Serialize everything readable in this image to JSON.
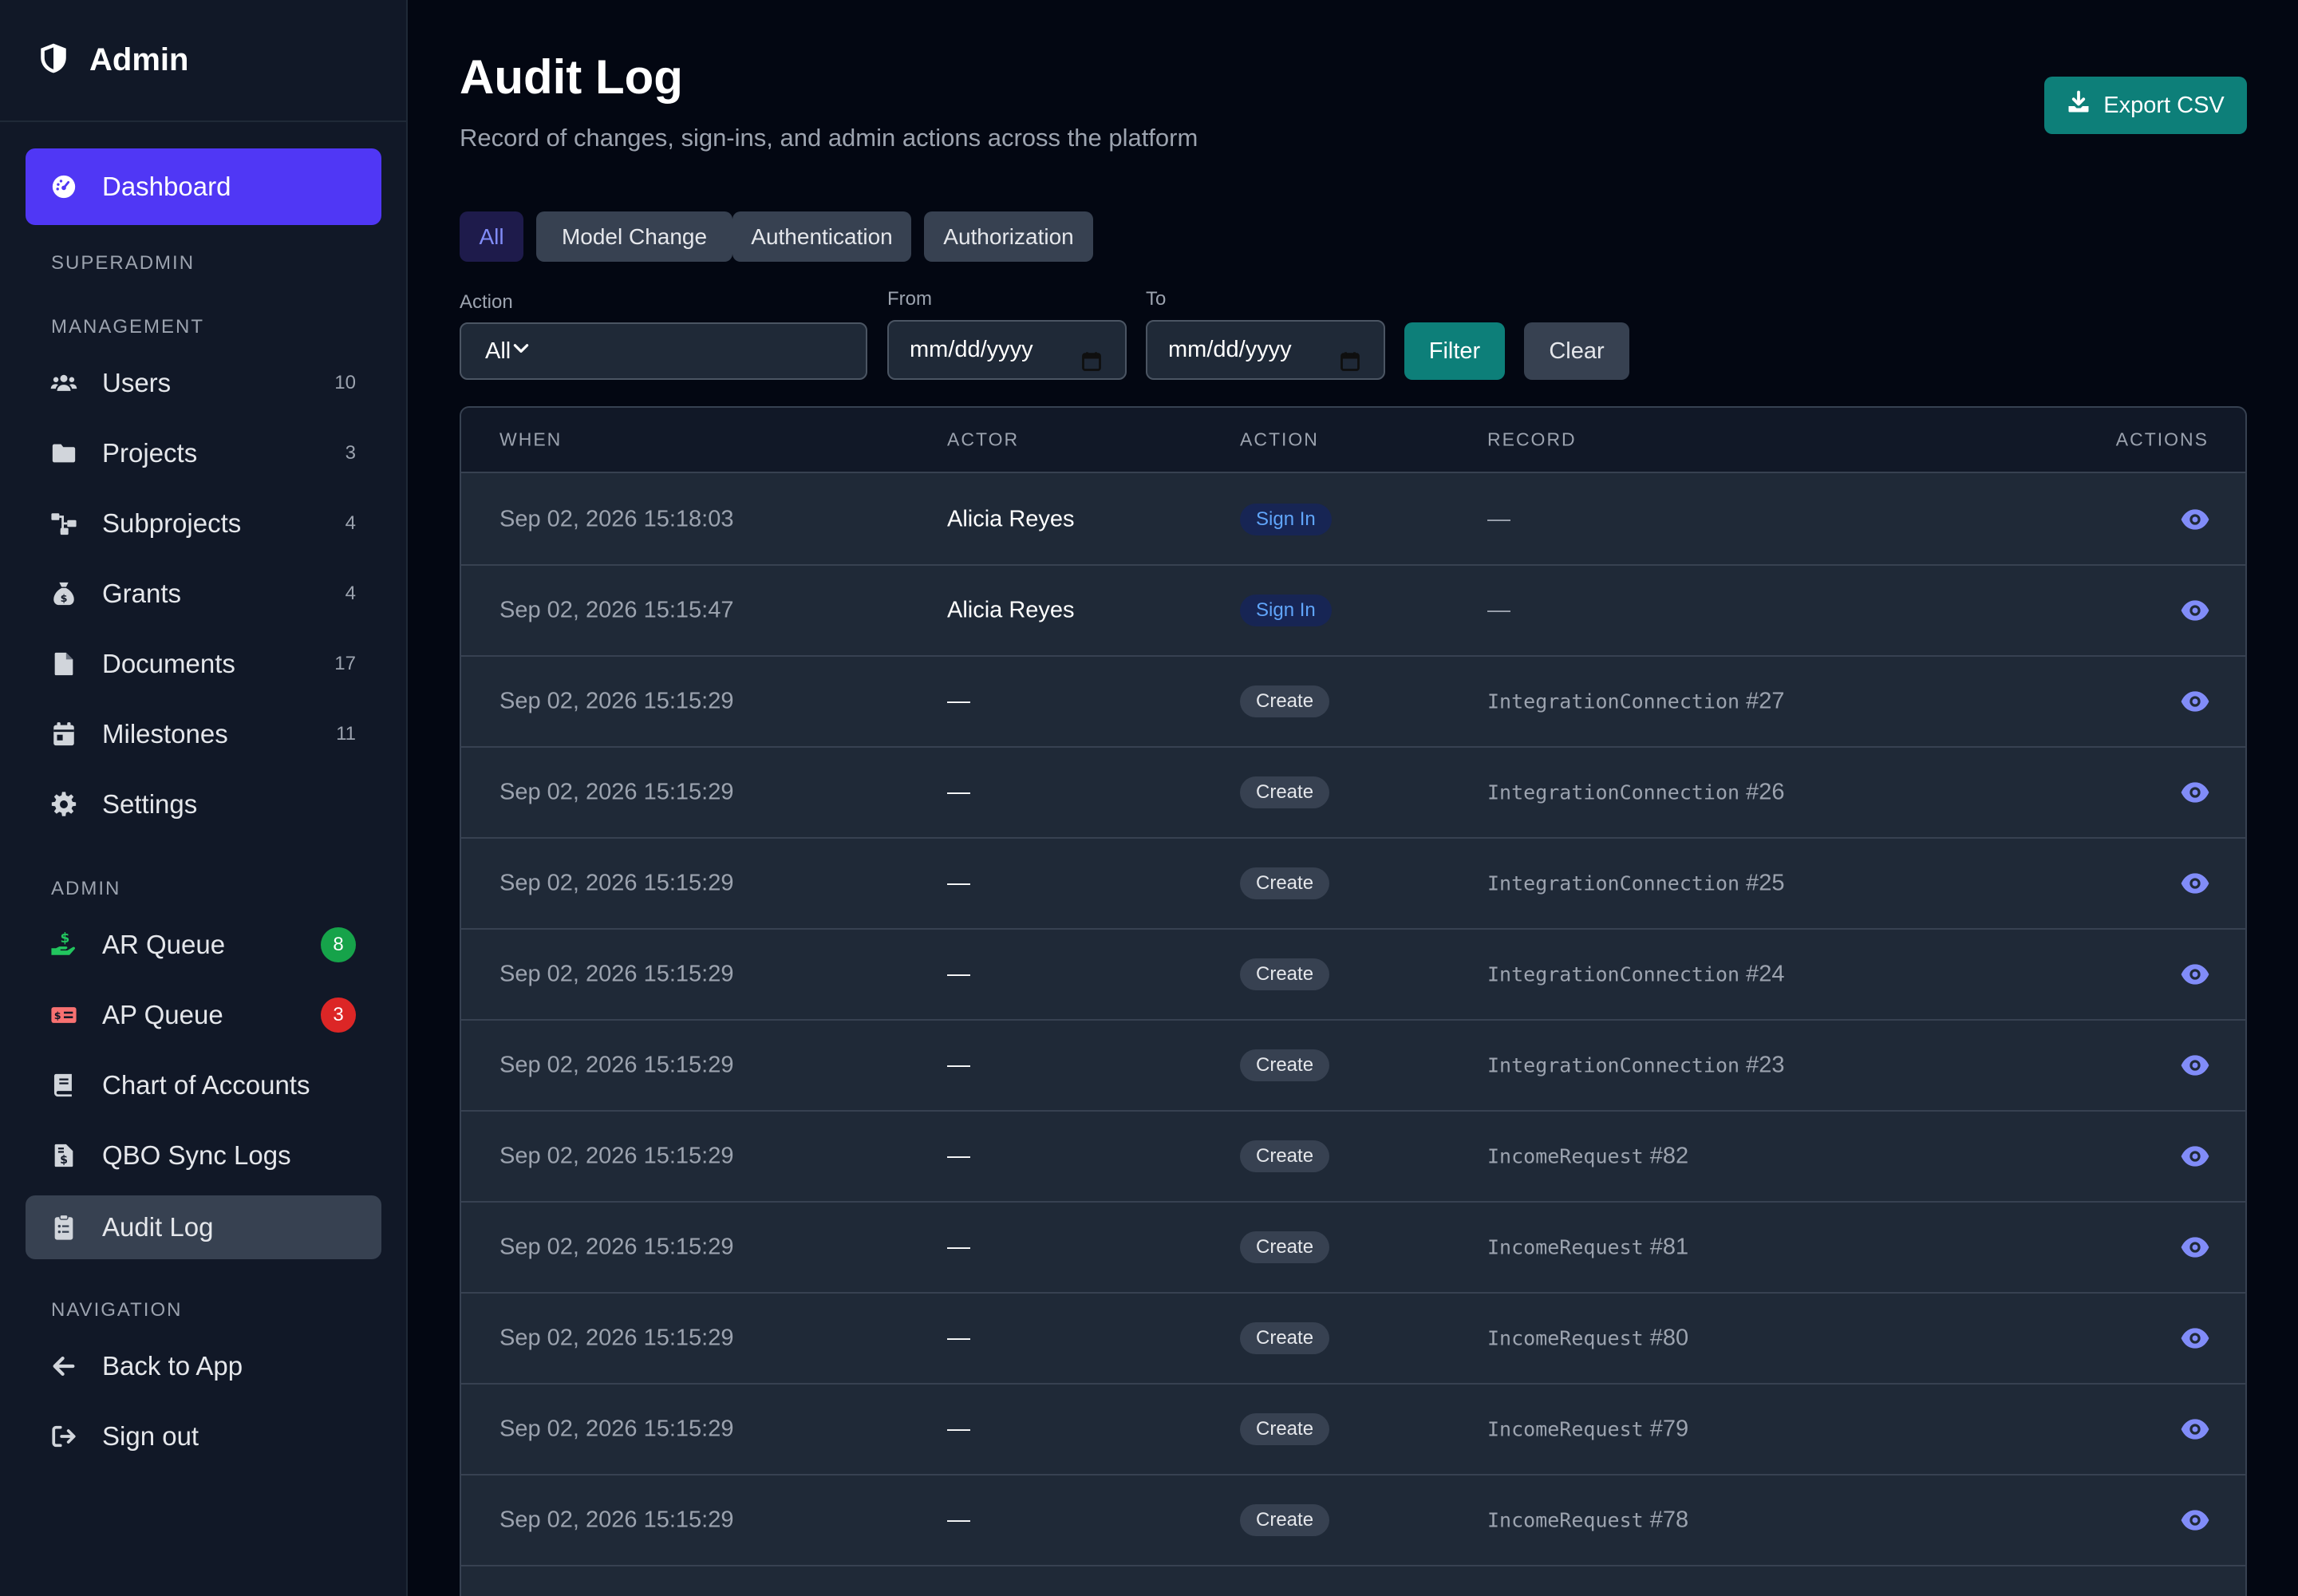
{
  "sidebar": {
    "brand": {
      "title": "Admin",
      "icon": "shield-icon"
    },
    "dashboard": {
      "label": "Dashboard",
      "icon": "gauge-icon"
    },
    "sections": {
      "superadmin": "SUPERADMIN",
      "management": "MANAGEMENT",
      "admin": "ADMIN",
      "navigation": "NAVIGATION"
    },
    "management": [
      {
        "label": "Users",
        "count": "10",
        "icon": "users-icon"
      },
      {
        "label": "Projects",
        "count": "3",
        "icon": "folder-icon"
      },
      {
        "label": "Subprojects",
        "count": "4",
        "icon": "sitemap-icon"
      },
      {
        "label": "Grants",
        "count": "4",
        "icon": "money-bag-icon"
      },
      {
        "label": "Documents",
        "count": "17",
        "icon": "file-icon"
      },
      {
        "label": "Milestones",
        "count": "11",
        "icon": "calendar-icon"
      },
      {
        "label": "Settings",
        "count": "",
        "icon": "gear-icon"
      }
    ],
    "admin": [
      {
        "label": "AR Queue",
        "badge": "8",
        "badge_color": "#16a34a",
        "icon": "hand-dollar-icon",
        "icon_color": "#22c55e"
      },
      {
        "label": "AP Queue",
        "badge": "3",
        "badge_color": "#dc2626",
        "icon": "money-check-icon",
        "icon_color": "#f87171"
      },
      {
        "label": "Chart of Accounts",
        "icon": "book-icon"
      },
      {
        "label": "QBO Sync Logs",
        "icon": "invoice-dollar-icon"
      },
      {
        "label": "Audit Log",
        "icon": "clipboard-list-icon"
      }
    ],
    "navigation": [
      {
        "label": "Back to App",
        "icon": "arrow-left-icon"
      },
      {
        "label": "Sign out",
        "icon": "sign-out-icon"
      }
    ]
  },
  "header": {
    "title": "Audit Log",
    "subtitle": "Record of changes, sign-ins, and admin actions across the platform",
    "export_label": "Export CSV"
  },
  "tabs": [
    {
      "label": "All",
      "active": true
    },
    {
      "label": "Model Change"
    },
    {
      "label": "Authentication"
    },
    {
      "label": "Authorization"
    }
  ],
  "filters": {
    "action_label": "Action",
    "action_value": "All",
    "from_label": "From",
    "from_placeholder": "mm/dd/yyyy",
    "to_label": "To",
    "to_placeholder": "mm/dd/yyyy",
    "filter_label": "Filter",
    "clear_label": "Clear"
  },
  "table": {
    "columns": [
      "WHEN",
      "ACTOR",
      "ACTION",
      "RECORD",
      "ACTIONS"
    ],
    "rows": [
      {
        "when": "Sep 02, 2026 15:18:03",
        "actor": "Alicia Reyes",
        "action": "Sign In",
        "type": "signin",
        "record_name": "",
        "record_id": "—"
      },
      {
        "when": "Sep 02, 2026 15:15:47",
        "actor": "Alicia Reyes",
        "action": "Sign In",
        "type": "signin",
        "record_name": "",
        "record_id": "—"
      },
      {
        "when": "Sep 02, 2026 15:15:29",
        "actor": "—",
        "action": "Create",
        "type": "create",
        "record_name": "IntegrationConnection",
        "record_id": " #27"
      },
      {
        "when": "Sep 02, 2026 15:15:29",
        "actor": "—",
        "action": "Create",
        "type": "create",
        "record_name": "IntegrationConnection",
        "record_id": " #26"
      },
      {
        "when": "Sep 02, 2026 15:15:29",
        "actor": "—",
        "action": "Create",
        "type": "create",
        "record_name": "IntegrationConnection",
        "record_id": " #25"
      },
      {
        "when": "Sep 02, 2026 15:15:29",
        "actor": "—",
        "action": "Create",
        "type": "create",
        "record_name": "IntegrationConnection",
        "record_id": " #24"
      },
      {
        "when": "Sep 02, 2026 15:15:29",
        "actor": "—",
        "action": "Create",
        "type": "create",
        "record_name": "IntegrationConnection",
        "record_id": " #23"
      },
      {
        "when": "Sep 02, 2026 15:15:29",
        "actor": "—",
        "action": "Create",
        "type": "create",
        "record_name": "IncomeRequest",
        "record_id": " #82"
      },
      {
        "when": "Sep 02, 2026 15:15:29",
        "actor": "—",
        "action": "Create",
        "type": "create",
        "record_name": "IncomeRequest",
        "record_id": " #81"
      },
      {
        "when": "Sep 02, 2026 15:15:29",
        "actor": "—",
        "action": "Create",
        "type": "create",
        "record_name": "IncomeRequest",
        "record_id": " #80"
      },
      {
        "when": "Sep 02, 2026 15:15:29",
        "actor": "—",
        "action": "Create",
        "type": "create",
        "record_name": "IncomeRequest",
        "record_id": " #79"
      },
      {
        "when": "Sep 02, 2026 15:15:29",
        "actor": "—",
        "action": "Create",
        "type": "create",
        "record_name": "IncomeRequest",
        "record_id": " #78"
      }
    ]
  },
  "colors": {
    "accent": "#5037f5",
    "teal": "#0d7f79",
    "eye": "#818cf8"
  }
}
